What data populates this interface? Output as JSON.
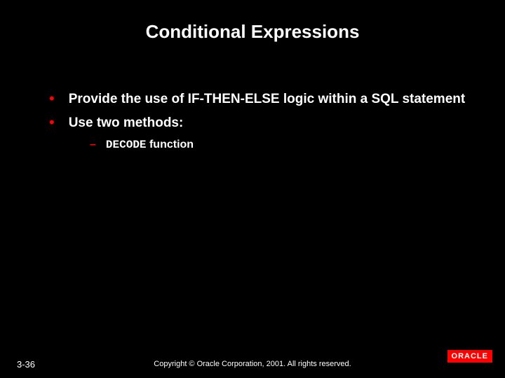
{
  "slide": {
    "title": "Conditional Expressions",
    "bullets": [
      {
        "text": "Provide the use of IF-THEN-ELSE logic within a SQL statement"
      },
      {
        "text": "Use two methods:"
      }
    ],
    "sub_bullets": [
      {
        "code": "DECODE",
        "tail": " function"
      }
    ],
    "page_number": "3-36",
    "copyright": "Copyright © Oracle Corporation, 2001. All rights reserved.",
    "logo_text": "ORACLE"
  }
}
